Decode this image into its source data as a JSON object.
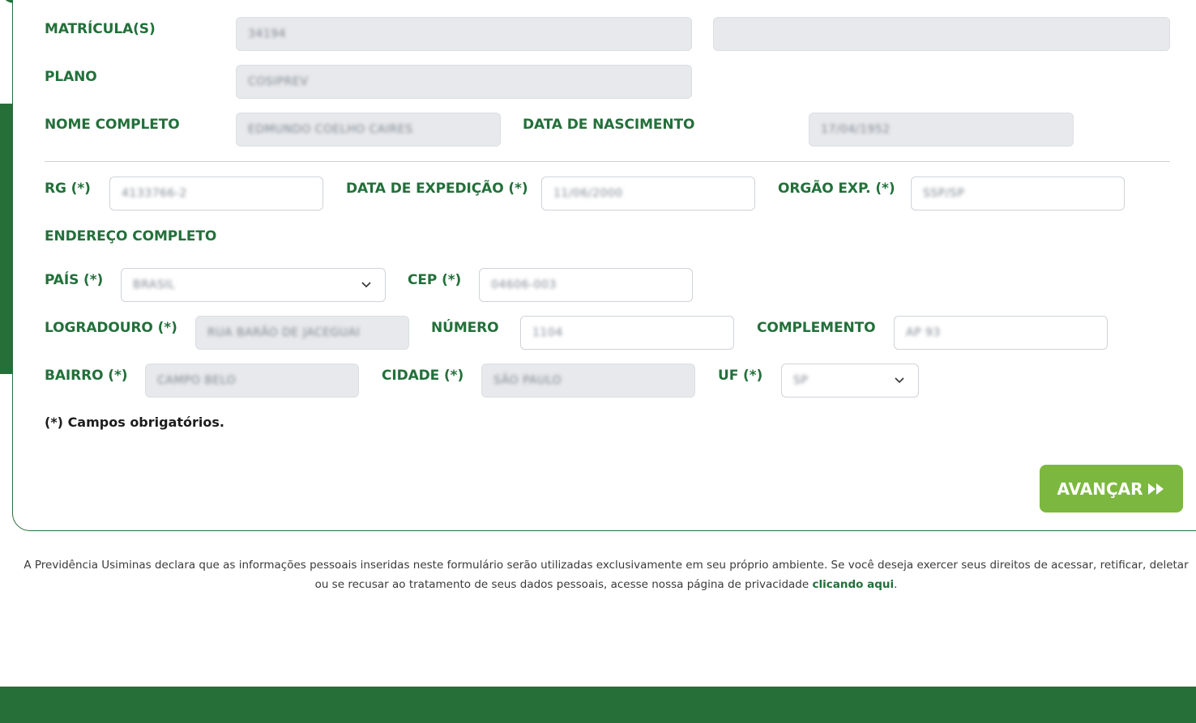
{
  "form": {
    "matricula_label": "MATRÍCULA(S)",
    "matricula_value": "34194",
    "matricula_value_2": "",
    "plano_label": "PLANO",
    "plano_value": "COSIPREV",
    "nome_label": "NOME COMPLETO",
    "nome_value": "EDMUNDO COELHO CAIRES",
    "nascimento_label": "DATA DE NASCIMENTO",
    "nascimento_value": "17/04/1952",
    "rg_label": "RG (*)",
    "rg_value": "4133766-2",
    "expedicao_label": "DATA DE EXPEDIÇÃO (*)",
    "expedicao_value": "11/06/2000",
    "orgao_label": "ORGÃO EXP. (*)",
    "orgao_value": "SSP/SP",
    "endereco_heading": "ENDEREÇO COMPLETO",
    "pais_label": "PAÍS (*)",
    "pais_value": "BRASIL",
    "cep_label": "CEP (*)",
    "cep_value": "04606-003",
    "logradouro_label": "LOGRADOURO (*)",
    "logradouro_value": "RUA BARÃO DE JACEGUAI",
    "numero_label": "NÚMERO",
    "numero_value": "1104",
    "complemento_label": "COMPLEMENTO",
    "complemento_value": "AP 93",
    "bairro_label": "BAIRRO (*)",
    "bairro_value": "CAMPO BELO",
    "cidade_label": "CIDADE (*)",
    "cidade_value": "SÃO PAULO",
    "uf_label": "UF (*)",
    "uf_value": "SP",
    "required_note": "(*) Campos obrigatórios.",
    "advance_label": "AVANÇAR"
  },
  "disclaimer": {
    "line_1": "A Previdência Usiminas declara que as informações pessoais inseridas neste formulário serão utilizadas exclusivamente em seu próprio ambiente. Se você deseja exercer seus direitos de acessar, retificar, deletar",
    "line_2": "ou se recusar ao tratamento de seus dados pessoais, acesse nossa página de privacidade ",
    "link": "clicando aqui",
    "end": "."
  },
  "colors": {
    "primary_green": "#276f38",
    "accent_green": "#7eb93a",
    "label_green": "#22703a"
  },
  "icons": [
    "chevron-down-icon",
    "double-chevron-right-icon"
  ]
}
